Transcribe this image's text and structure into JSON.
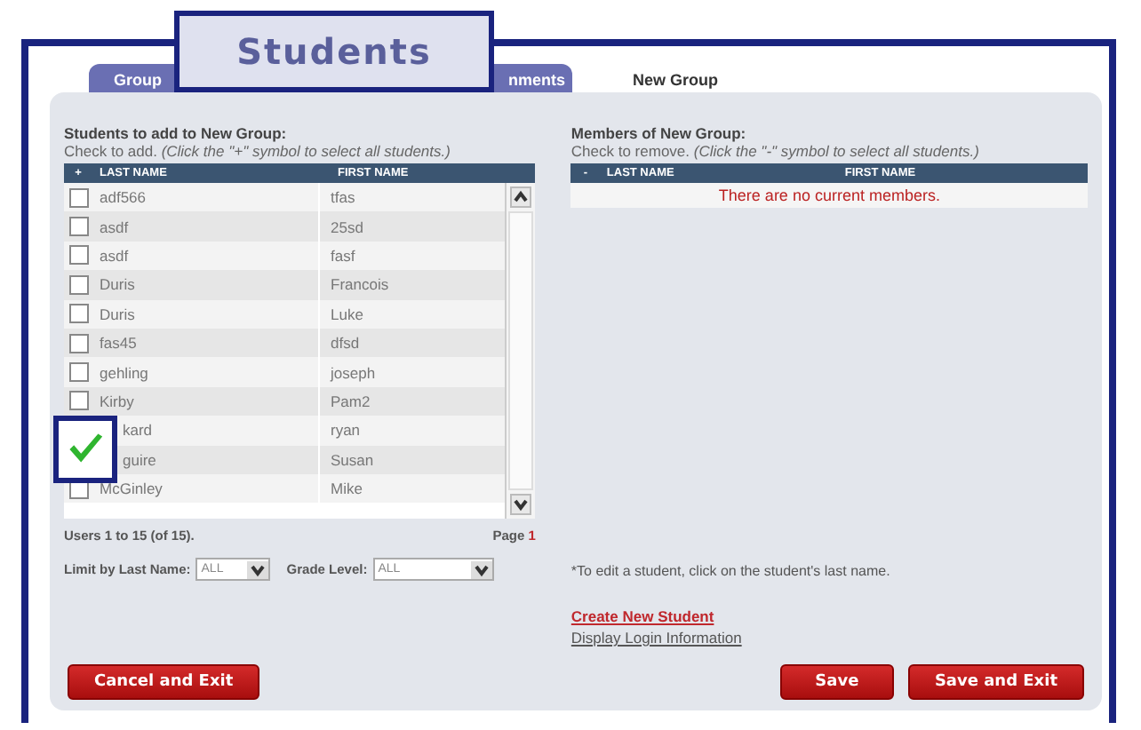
{
  "callout_title": "Students",
  "tabs": [
    {
      "label": "Group",
      "selected": false
    },
    {
      "label": "nments",
      "selected": false
    },
    {
      "label": "New Group",
      "selected": true
    }
  ],
  "left": {
    "heading": "Students to add to New Group:",
    "instruction": "Check to add.",
    "hint": "(Click the \"+\" symbol to select all students.)",
    "columns": [
      "+",
      "LAST NAME",
      "FIRST NAME"
    ],
    "rows": [
      {
        "last": "adf566",
        "first": "tfas",
        "checked": false,
        "covered": false
      },
      {
        "last": "asdf",
        "first": "25sd",
        "checked": false,
        "covered": false
      },
      {
        "last": "asdf",
        "first": "fasf",
        "checked": false,
        "covered": false
      },
      {
        "last": "Duris",
        "first": "Francois",
        "checked": false,
        "covered": false
      },
      {
        "last": "Duris",
        "first": "Luke",
        "checked": false,
        "covered": false
      },
      {
        "last": "fas45",
        "first": "dfsd",
        "checked": false,
        "covered": false
      },
      {
        "last": "gehling",
        "first": "joseph",
        "checked": false,
        "covered": false
      },
      {
        "last": "Kirby",
        "first": "Pam2",
        "checked": false,
        "covered": false
      },
      {
        "last": "kard",
        "first": "ryan",
        "covered": true
      },
      {
        "last": "guire",
        "first": "Susan",
        "covered": true
      },
      {
        "last": "McGinley",
        "first": "Mike",
        "checked": false,
        "covered": false
      }
    ],
    "users": "Users 1 to 15 (of 15).",
    "page_label": "Page",
    "page": "1",
    "filters": [
      {
        "label": "Limit by Last Name:",
        "value": "ALL"
      },
      {
        "label": "Grade Level:",
        "value": "ALL"
      }
    ]
  },
  "right": {
    "heading": "Members of New Group:",
    "instruction": "Check to remove.",
    "hint": "(Click the \"-\" symbol to select all students.)",
    "columns": [
      "-",
      "LAST NAME",
      "FIRST NAME"
    ],
    "empty": "There are no current members.",
    "note": "*To edit a student, click on the student's last name.",
    "links": [
      {
        "label": "Create New Student",
        "kind": "primary"
      },
      {
        "label": "Display Login Information",
        "kind": "secondary"
      }
    ]
  },
  "buttons": {
    "left": [
      "Cancel and Exit"
    ],
    "right": [
      "Save",
      "Save and Exit"
    ]
  },
  "callout_check": {
    "checked": true
  }
}
